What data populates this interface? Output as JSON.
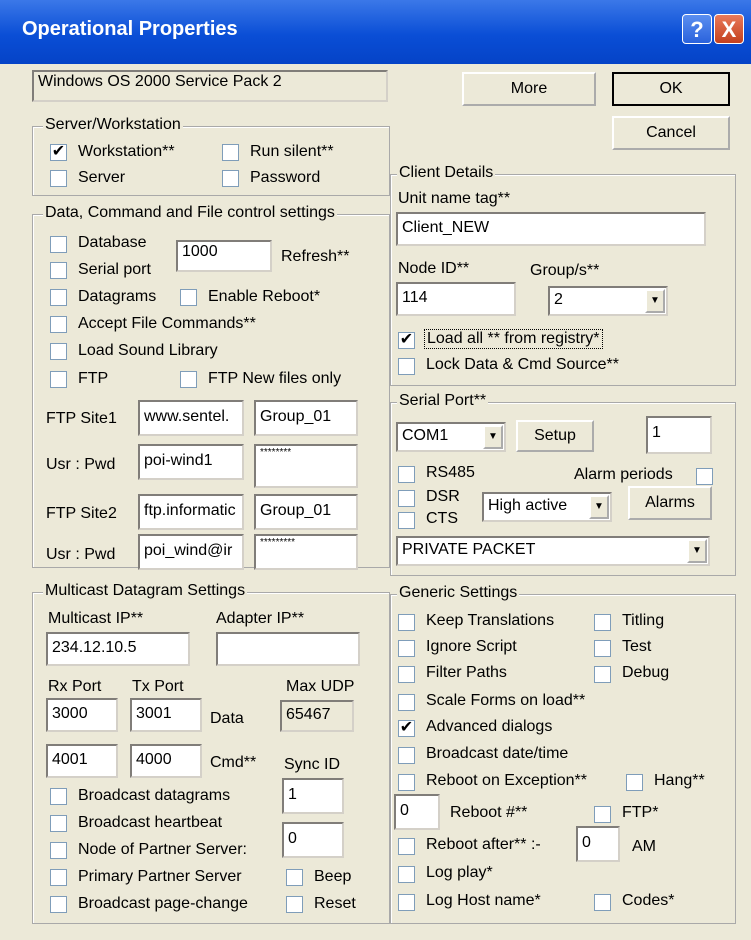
{
  "window": {
    "title": "Operational Properties",
    "help_icon": "?",
    "close_icon": "X"
  },
  "os_info": "Windows OS 2000 Service Pack 2",
  "buttons": {
    "more": "More",
    "ok": "OK",
    "cancel": "Cancel"
  },
  "server_ws": {
    "legend": "Server/Workstation",
    "workstation": "Workstation**",
    "run_silent": "Run silent**",
    "server": "Server",
    "password": "Password"
  },
  "data_cmd": {
    "legend": "Data, Command and File control settings",
    "database": "Database",
    "refresh_value": "1000",
    "refresh": "Refresh**",
    "serial_port": "Serial port",
    "datagrams": "Datagrams",
    "enable_reboot": "Enable Reboot*",
    "accept_file": "Accept File Commands**",
    "load_sound": "Load Sound Library",
    "ftp": "FTP",
    "ftp_new": "FTP New files only",
    "ftp_site1": "FTP Site1",
    "site1_host": "www.sentel.",
    "site1_group": "Group_01",
    "usr_pwd1": "Usr : Pwd",
    "usr1": "poi-wind1",
    "pwd1": "********",
    "ftp_site2": "FTP Site2",
    "site2_host": "ftp.informatic",
    "site2_group": "Group_01",
    "usr_pwd2": "Usr : Pwd",
    "usr2": "poi_wind@ir",
    "pwd2": "*********"
  },
  "multicast": {
    "legend": "Multicast Datagram Settings",
    "mc_ip_label": "Multicast IP**",
    "mc_ip": "234.12.10.5",
    "adapter_label": "Adapter IP**",
    "adapter_ip": "",
    "rx_label": "Rx Port",
    "tx_label": "Tx Port",
    "max_udp_label": "Max UDP",
    "rx_data": "3000",
    "tx_data": "3001",
    "data": "Data",
    "max_udp": "65467",
    "rx_cmd": "4001",
    "tx_cmd": "4000",
    "cmd": "Cmd**",
    "sync_label": "Sync ID",
    "sync_id": "1",
    "bcast_dgram": "Broadcast datagrams",
    "bcast_hb": "Broadcast heartbeat",
    "node_partner": "Node of Partner Server:",
    "node_val": "0",
    "primary": "Primary Partner Server",
    "beep": "Beep",
    "bcast_page": "Broadcast page-change",
    "reset": "Reset"
  },
  "client": {
    "legend": "Client Details",
    "unit_label": "Unit name tag**",
    "unit": "Client_NEW",
    "node_label": "Node ID**",
    "node_id": "114",
    "group_label": "Group/s**",
    "group": "2",
    "load_all": "Load all ** from registry*",
    "lock": "Lock Data & Cmd Source**"
  },
  "serial": {
    "legend": "Serial Port**",
    "com": "COM1",
    "setup": "Setup",
    "value": "1",
    "rs485": "RS485",
    "alarm_periods": "Alarm periods",
    "dsr": "DSR",
    "active": "High active",
    "alarms": "Alarms",
    "cts": "CTS",
    "packet": "PRIVATE PACKET"
  },
  "generic": {
    "legend": "Generic Settings",
    "keep": "Keep Translations",
    "titling": "Titling",
    "ignore": "Ignore Script",
    "test": "Test",
    "filter": "Filter Paths",
    "debug": "Debug",
    "scale": "Scale Forms on load**",
    "advanced": "Advanced dialogs",
    "bcast_dt": "Broadcast date/time",
    "reboot_exc": "Reboot on Exception**",
    "hang": "Hang**",
    "reboot_num_val": "0",
    "reboot_num": "Reboot #**",
    "ftp": "FTP*",
    "reboot_after": "Reboot after** :-",
    "reboot_hr": "0",
    "am": "AM",
    "log_play": "Log play*",
    "log_host": "Log Host name*",
    "codes": "Codes*"
  },
  "check_mark": "✔"
}
